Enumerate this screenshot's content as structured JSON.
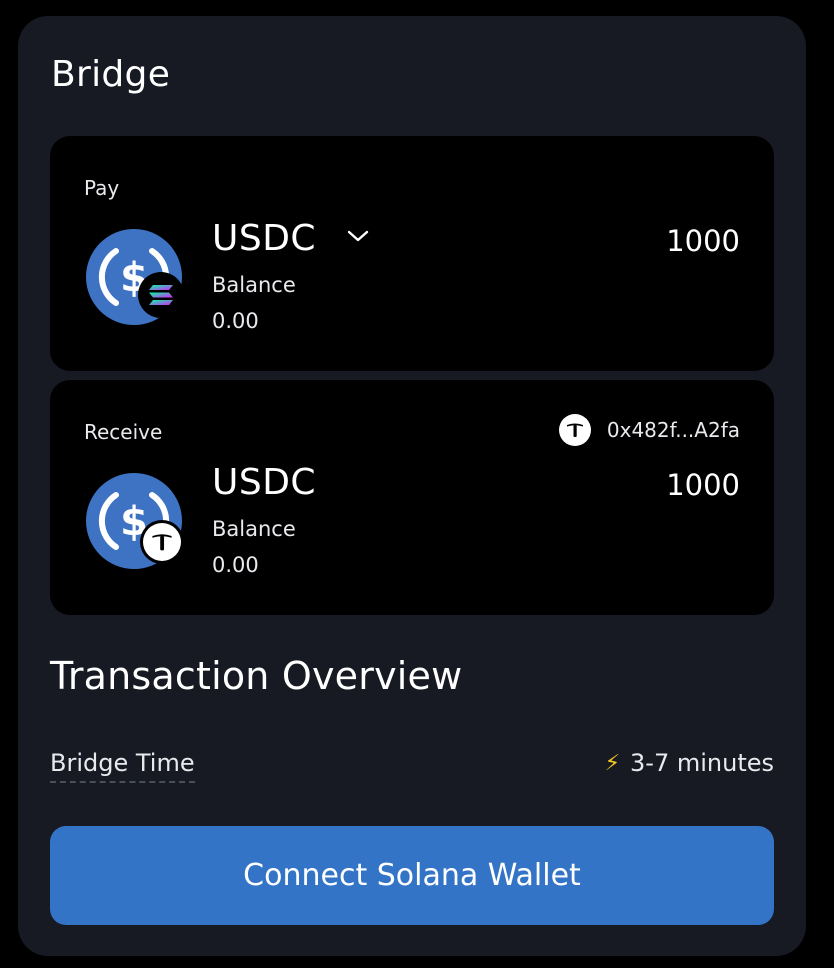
{
  "bridge": {
    "title": "Bridge"
  },
  "pay": {
    "label": "Pay",
    "token_symbol": "USDC",
    "balance_label": "Balance",
    "balance_value": "0.00",
    "amount": "1000",
    "chain_icon": "solana-icon"
  },
  "receive": {
    "label": "Receive",
    "address": "0x482f...A2fa",
    "token_symbol": "USDC",
    "balance_label": "Balance",
    "balance_value": "0.00",
    "amount": "1000",
    "chain_icon": "t-chain-icon"
  },
  "overview": {
    "title": "Transaction Overview",
    "bridge_time_label": "Bridge Time",
    "bridge_time_value": "3-7 minutes",
    "bolt_icon": "lightning-icon"
  },
  "cta": {
    "label": "Connect Solana Wallet"
  },
  "colors": {
    "card_bg": "#171a23",
    "panel_bg": "#000000",
    "accent": "#3374c6",
    "usdc_blue": "#3e73c4"
  }
}
